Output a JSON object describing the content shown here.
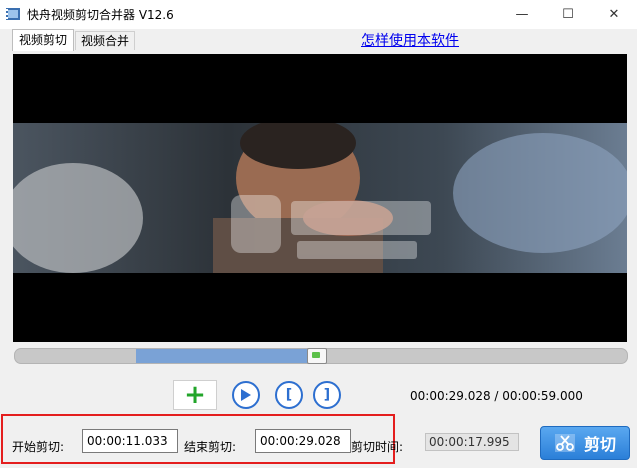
{
  "window": {
    "title": "快舟视频剪切合并器 V12.6",
    "minimize": "—",
    "maximize": "☐",
    "close": "✕"
  },
  "tabs": [
    {
      "label": "视频剪切",
      "active": true
    },
    {
      "label": "视频合并",
      "active": false
    }
  ],
  "help_link": "怎样使用本软件",
  "playback": {
    "position_text": "00:00:29.028 / 00:00:59.000",
    "selection_start_fraction": 0.197,
    "selection_end_fraction": 0.492,
    "playhead_fraction": 0.492
  },
  "controls": {
    "add_icon": "plus-icon",
    "play_icon": "play-icon",
    "mark_in_icon": "bracket-left-icon",
    "mark_out_icon": "bracket-right-icon",
    "mark_in_glyph": "[",
    "mark_out_glyph": "]",
    "add_glyph": "+"
  },
  "cut": {
    "start_label": "开始剪切:",
    "start_value": "00:00:11.033",
    "end_label": "结束剪切:",
    "end_value": "00:00:29.028",
    "duration_label": "剪切时间:",
    "duration_value": "00:00:17.995",
    "button_label": "剪切"
  },
  "colors": {
    "highlight_border": "#e41e1e",
    "link": "#0000ee",
    "accent_blue": "#2d6fd0",
    "slider_selection": "#7aa2d6",
    "add_green": "#22a52a"
  }
}
